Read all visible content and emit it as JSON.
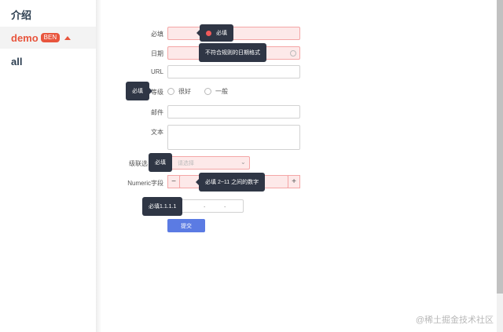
{
  "sidebar": {
    "items": [
      {
        "label": "介绍"
      },
      {
        "label": "demo",
        "badge": "BEN"
      },
      {
        "label": "all"
      }
    ]
  },
  "form": {
    "required_label": "必填",
    "date_label": "日期",
    "url_label": "URL",
    "level_label": "等级",
    "level_options": [
      "很好",
      "一般"
    ],
    "email_label": "邮件",
    "text_label": "文本",
    "cascade_label": "级联选",
    "cascade_placeholder": "请选择",
    "numeric_label": "Numeric字段",
    "stepper_minus": "−",
    "stepper_plus": "+",
    "ip_dots": [
      ".",
      "."
    ],
    "submit_label": "提交"
  },
  "tooltips": {
    "required": "必填",
    "date": "不符合规则的日期格式",
    "level": "必填",
    "cascade": "必填",
    "numeric": "必填 2~11 之间的数字",
    "ip": "必填1.1.1.1"
  },
  "watermark": "@稀土掘金技术社区",
  "colors": {
    "accent": "#e8553d",
    "tooltip_bg": "#2f3645",
    "error_bg": "#fde9e9",
    "submit_bg": "#5b7be3"
  }
}
